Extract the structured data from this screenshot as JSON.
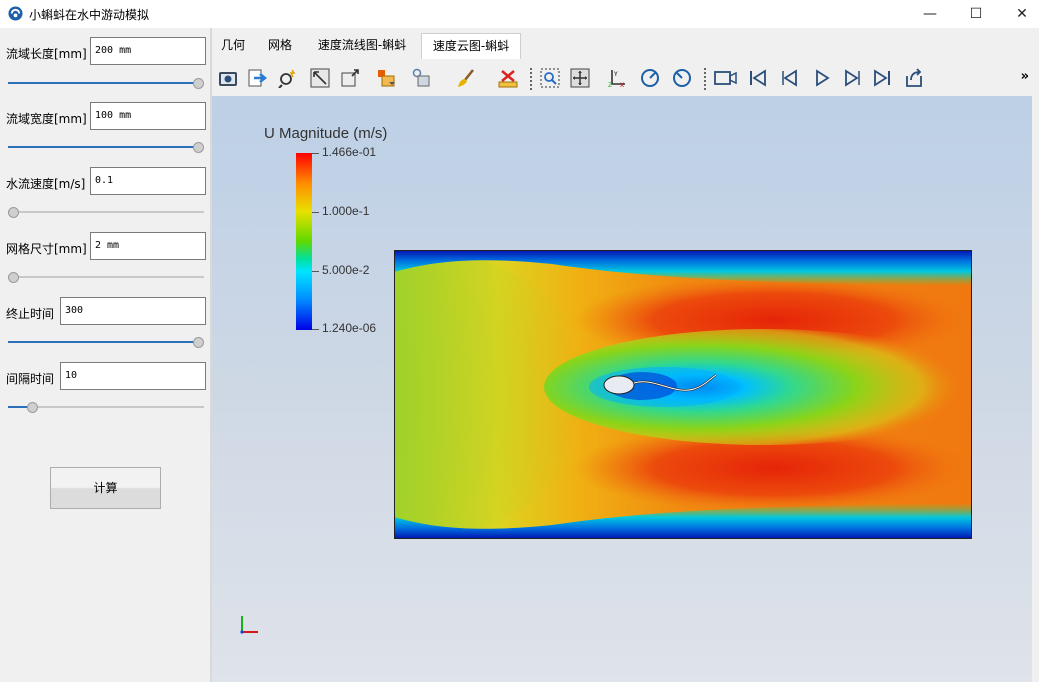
{
  "window": {
    "title": "小蝌蚪在水中游动模拟",
    "icon": "app-logo-icon",
    "controls": [
      "minimize-icon",
      "maximize-icon",
      "close-icon"
    ]
  },
  "params": {
    "length": {
      "label": "流域长度[mm]",
      "value": "200 mm",
      "slider_fraction": 1.0
    },
    "width": {
      "label": "流域宽度[mm]",
      "value": "100 mm",
      "slider_fraction": 1.0
    },
    "velocity": {
      "label": "水流速度[m/s]",
      "value": "0.1",
      "slider_fraction": 0.0
    },
    "mesh": {
      "label": "网格尺寸[mm]",
      "value": "2 mm",
      "slider_fraction": 0.0
    },
    "end_time": {
      "label": "终止时间",
      "value": "300",
      "slider_fraction": 1.0
    },
    "interval": {
      "label": "间隔时间",
      "value": "10",
      "slider_fraction": 0.1
    }
  },
  "calc_button": "计算",
  "tabs": [
    {
      "label": "几何",
      "active": false
    },
    {
      "label": "网格",
      "active": false
    },
    {
      "label": "速度流线图-蝌蚪",
      "active": false
    },
    {
      "label": "速度云图-蝌蚪",
      "active": true
    }
  ],
  "toolbar": {
    "icons": [
      "camera-icon",
      "export-icon",
      "zoom-magic-icon",
      "reset-camera-icon",
      "zoom-box-icon",
      "color-by-icon",
      "representation-icon",
      "brush-icon",
      "ruler-icon",
      "zoom-select-icon",
      "fit-icon",
      "axes-orient-icon",
      "rotate-cw-icon",
      "rotate-ccw-icon",
      "video-icon",
      "first-frame-icon",
      "prev-frame-icon",
      "play-icon",
      "next-frame-icon",
      "last-frame-icon",
      "loop-icon"
    ],
    "more": "»"
  },
  "viewport": {
    "legend_title": "U Magnitude (m/s)",
    "legend_ticks": [
      "1.466e-01",
      "1.000e-1",
      "5.000e-2",
      "1.240e-06"
    ],
    "colors": {
      "max": "#ff0000",
      "mid": "#5fd800",
      "min": "#0000e6"
    }
  }
}
